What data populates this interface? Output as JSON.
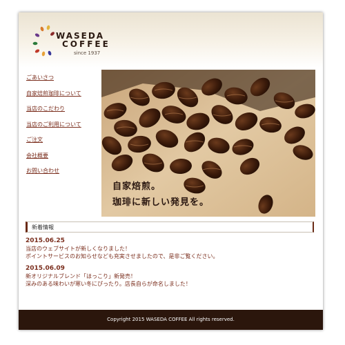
{
  "logo": {
    "line1": "WASEDA",
    "line2": "COFFEE",
    "since": "since 1937"
  },
  "nav": [
    "ごあいさつ",
    "自家焙煎珈琲について",
    "当店のこだわり",
    "当店のご利用について",
    "ご注文",
    "会社概要",
    "お問い合わせ"
  ],
  "hero": {
    "line1": "自家焙煎。",
    "line2": "珈琲に新しい発見を。"
  },
  "news": {
    "title": "新着情報",
    "items": [
      {
        "date": "2015.06.25",
        "line1": "当店のウェブサイトが新しくなりました！",
        "line2": "ポイントサービスのお知らせなども充実させましたので、是非ご覧ください。"
      },
      {
        "date": "2015.06.09",
        "line1": "新オリジナルブレンド「ほっこり」新発売！",
        "line2": "深みのある味わいが寒い冬にぴったり。店長自らが命名しました！"
      }
    ]
  },
  "footer": {
    "copyright": "Copyright 2015 WASEDA COFFEE All rights reserved."
  },
  "colors": {
    "link": "#7a2d1c",
    "footer_bg": "#2b160c",
    "accent": "#6a2a14"
  }
}
